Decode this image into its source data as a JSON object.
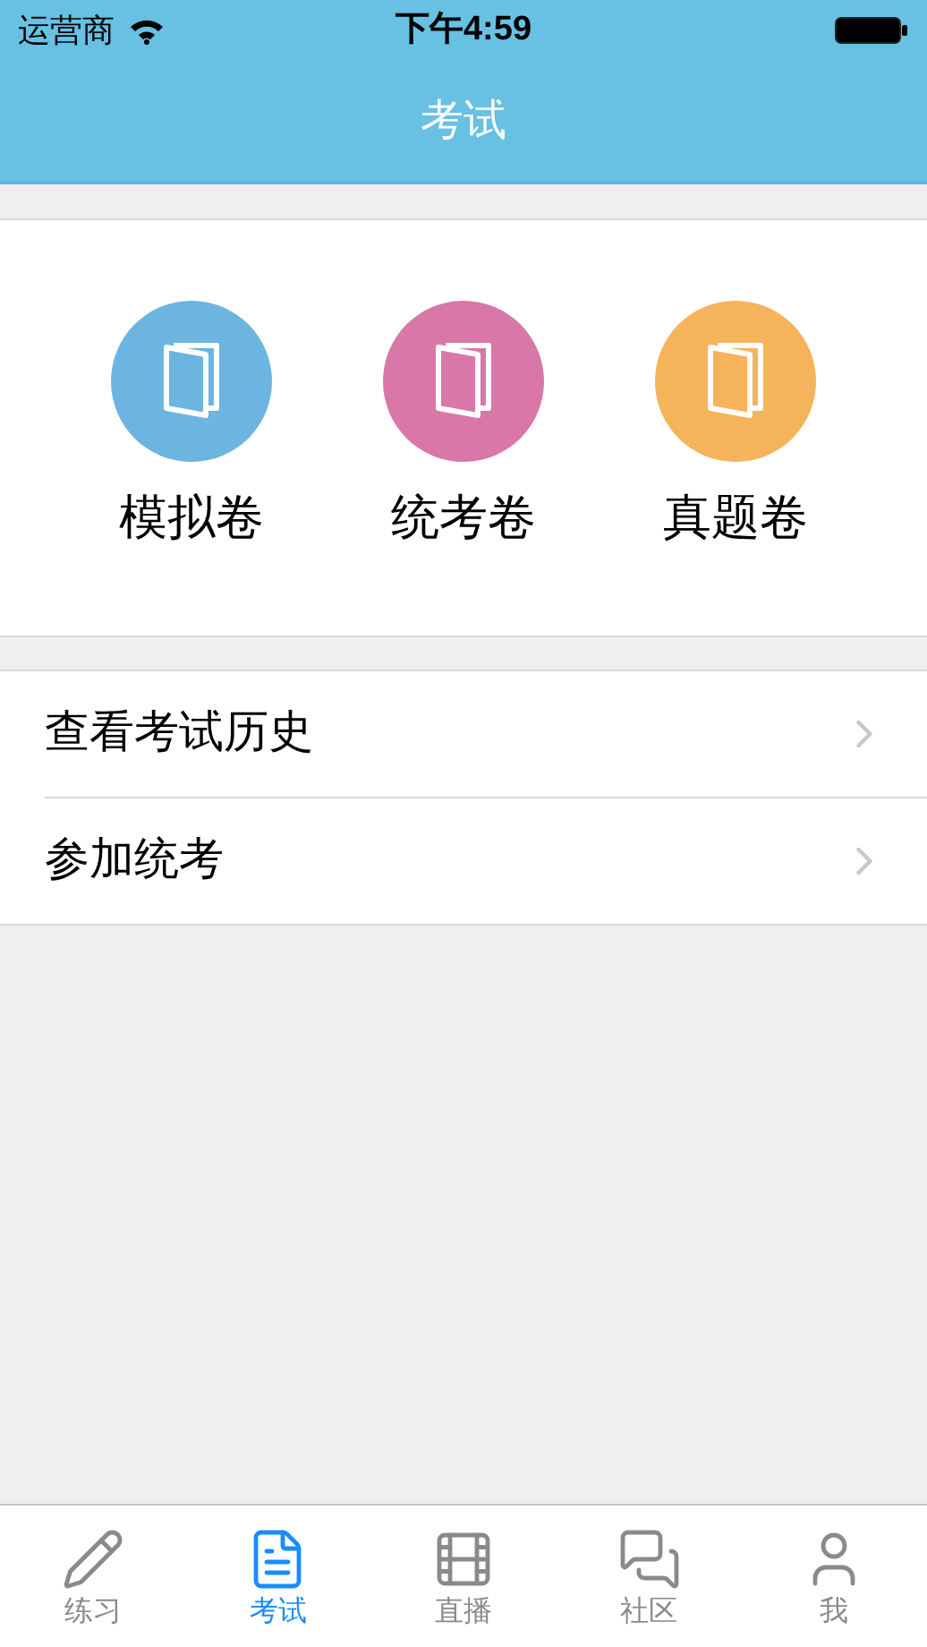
{
  "status_bar": {
    "carrier": "运营商",
    "time": "下午4:59"
  },
  "nav_bar": {
    "title": "考试"
  },
  "categories": [
    {
      "label": "模拟卷",
      "color": "#6cb5e0"
    },
    {
      "label": "统考卷",
      "color": "#d977a8"
    },
    {
      "label": "真题卷",
      "color": "#f5b35b"
    }
  ],
  "menu": [
    {
      "label": "查看考试历史"
    },
    {
      "label": "参加统考"
    }
  ],
  "tab_bar": [
    {
      "label": "练习",
      "selected": false
    },
    {
      "label": "考试",
      "selected": true
    },
    {
      "label": "直播",
      "selected": false
    },
    {
      "label": "社区",
      "selected": false
    },
    {
      "label": "我",
      "selected": false
    }
  ]
}
